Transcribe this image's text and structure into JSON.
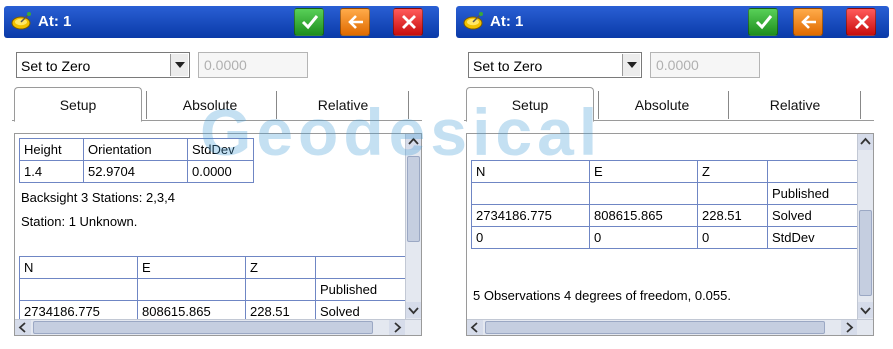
{
  "colors": {
    "titlebar": "#1446c0",
    "ok_button": "#2eaa2e",
    "back_button": "#f07d10",
    "close_button": "#e01e1e",
    "table_border": "#6f86c4",
    "watermark": "#48a0d6"
  },
  "left_panel": {
    "title": "At: 1",
    "mode_select": {
      "value": "Set to Zero"
    },
    "value_input": {
      "value": "0.0000"
    },
    "tabs": [
      {
        "label": "Setup",
        "active": true
      },
      {
        "label": "Absolute",
        "active": false
      },
      {
        "label": "Relative",
        "active": false
      }
    ],
    "setup_table": {
      "headers": [
        "Height",
        "Orientation",
        "StdDev"
      ],
      "row": [
        "1.4",
        "52.9704",
        "0.0000"
      ]
    },
    "backsight_line": "Backsight 3 Stations: 2,3,4",
    "station_line": "Station: 1 Unknown.",
    "coord_table": {
      "headers": [
        "N",
        "E",
        "Z",
        ""
      ],
      "row_published": [
        "",
        "",
        "",
        "Published"
      ],
      "row_solved_partial": [
        "2734186.775",
        "808615.865",
        "228.51",
        "Solved"
      ]
    }
  },
  "right_panel": {
    "title": "At: 1",
    "mode_select": {
      "value": "Set to Zero"
    },
    "value_input": {
      "value": "0.0000"
    },
    "tabs": [
      {
        "label": "Setup",
        "active": true
      },
      {
        "label": "Absolute",
        "active": false
      },
      {
        "label": "Relative",
        "active": false
      }
    ],
    "coord_table": {
      "headers": [
        "N",
        "E",
        "Z",
        ""
      ],
      "rows": [
        [
          "",
          "",
          "",
          "Published"
        ],
        [
          "2734186.775",
          "808615.865",
          "228.51",
          "Solved"
        ],
        [
          "0",
          "0",
          "0",
          "StdDev"
        ]
      ]
    },
    "summary_line": "5 Observations 4 degrees of freedom, 0.055."
  },
  "watermark": "Geodesical",
  "icons": {
    "app": "satellite-dish-icon",
    "ok": "checkmark-icon",
    "back": "arrow-left-icon",
    "close": "close-icon",
    "dropdown": "chevron-down-icon"
  }
}
